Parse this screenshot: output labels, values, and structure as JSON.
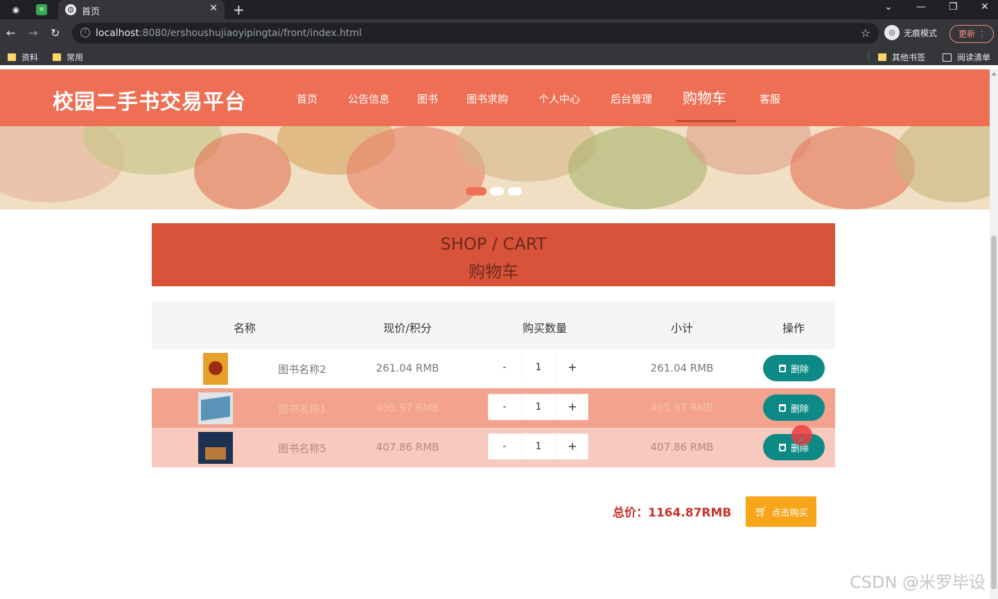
{
  "browser": {
    "tab_title": "首页",
    "url_host": "localhost",
    "url_rest": ":8080/ershoushujiaoyipingtai/front/index.html",
    "incognito_label": "无痕模式",
    "update_label": "更新",
    "bookmarks": [
      "资料",
      "常用"
    ],
    "other_bookmarks": "其他书签",
    "reading_list": "阅读清单"
  },
  "site": {
    "logo": "校园二手书交易平台",
    "menu": [
      {
        "label": "首页"
      },
      {
        "label": "公告信息"
      },
      {
        "label": "图书"
      },
      {
        "label": "图书求购"
      },
      {
        "label": "个人中心"
      },
      {
        "label": "后台管理"
      },
      {
        "label": "购物车",
        "active": true
      },
      {
        "label": "客服"
      }
    ]
  },
  "cart": {
    "heading_en": "SHOP / CART",
    "heading_cn": "购物车",
    "columns": [
      "名称",
      "现价/积分",
      "购买数量",
      "小计",
      "操作"
    ],
    "rows": [
      {
        "name": "图书名称2",
        "price": "261.04 RMB",
        "qty": "1",
        "subtotal": "261.04 RMB",
        "delete_label": "删除",
        "minus": "-",
        "plus": "+"
      },
      {
        "name": "图书名称1",
        "price": "495.97 RMB",
        "qty": "1",
        "subtotal": "495.97 RMB",
        "delete_label": "删除",
        "minus": "-",
        "plus": "+"
      },
      {
        "name": "图书名称5",
        "price": "407.86 RMB",
        "qty": "1",
        "subtotal": "407.86 RMB",
        "delete_label": "删除",
        "minus": "-",
        "plus": "+"
      }
    ],
    "total_label": "总价：",
    "total_value": "1164.87RMB",
    "buy_label": "点击购买"
  },
  "watermark": "CSDN @米罗毕设",
  "colors": {
    "header": "#ef6f55",
    "cart_banner": "#d9533a",
    "delete_button": "#0e8a86",
    "buy_button": "#f9a51a",
    "row2_bg": "#f3a28e",
    "row3_bg": "#f8c9bd"
  }
}
